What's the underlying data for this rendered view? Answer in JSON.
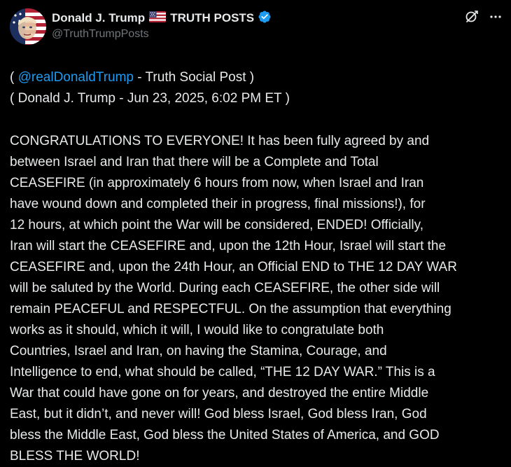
{
  "author": {
    "display_name": "Donald J. Trump",
    "account_suffix": "TRUTH POSTS",
    "handle": "@TruthTrumpPosts",
    "verified_color": "#1d9bf0"
  },
  "icons": {
    "avatar": "patriotic-portrait-avatar",
    "flag": "us-flag-emoji",
    "verified": "verified-badge-icon",
    "grok": "grok-icon",
    "more": "more-options-icon"
  },
  "post": {
    "meta_line1_prefix": "( ",
    "mention": "@realDonaldTrump",
    "meta_line1_suffix": " - Truth Social Post )",
    "meta_line2": "( Donald J. Trump - Jun 23, 2025, 6:02 PM ET )",
    "lines": [
      "CONGRATULATIONS TO EVERYONE! It has been fully agreed by and",
      "between Israel and Iran that there will be a Complete and Total",
      "CEASEFIRE (in approximately 6 hours from now, when Israel and Iran",
      "have wound down and completed their in progress, final missions!), for",
      "12 hours, at which point the War will be considered, ENDED! Officially,",
      "Iran will start the CEASEFIRE and, upon the 12th Hour, Israel will start the",
      "CEASEFIRE and, upon the 24th Hour, an Official END to THE 12 DAY WAR",
      "will be saluted by the World. During each CEASEFIRE, the other side will",
      "remain PEACEFUL and RESPECTFUL. On the assumption that everything",
      "works as it should, which it will, I would like to congratulate both",
      "Countries, Israel and Iran, on having the Stamina, Courage, and",
      "Intelligence to end, what should be called, “THE 12 DAY WAR.” This is a",
      "War that could have gone on for years, and destroyed the entire Middle",
      "East, but it didn’t, and never will! God bless Israel, God bless Iran, God",
      "bless the Middle East, God bless the United States of America, and GOD",
      "BLESS THE WORLD!"
    ]
  }
}
